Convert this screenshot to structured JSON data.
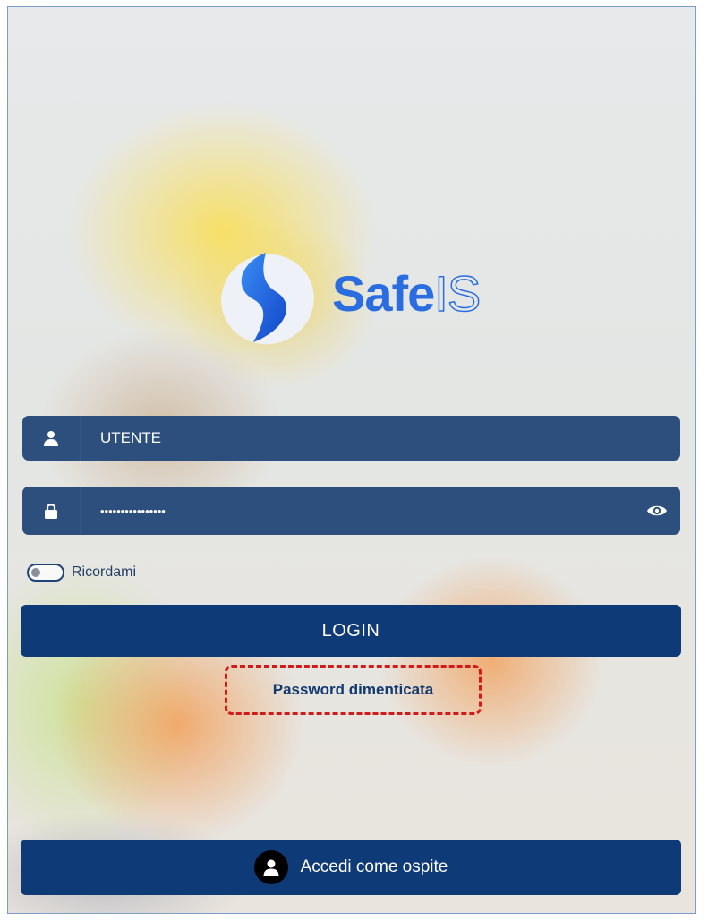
{
  "brand": {
    "name_part1": "Safe",
    "name_part2": "IS",
    "colors": {
      "primary": "#2a6de0",
      "dark_blue": "#0e3a78",
      "field_bg": "#2d4f7d",
      "highlight": "#d11a1a"
    }
  },
  "login_form": {
    "username": {
      "placeholder": "UTENTE",
      "value": "",
      "icon": "user-icon"
    },
    "password": {
      "value": "••••••••••••••••",
      "icon": "lock-icon",
      "toggle_icon": "eye-icon"
    },
    "remember": {
      "label": "Ricordami",
      "checked": false
    },
    "login_label": "LOGIN",
    "forgot_label": "Password dimenticata",
    "guest_label": "Accedi come ospite",
    "guest_icon": "person-avatar-icon"
  }
}
